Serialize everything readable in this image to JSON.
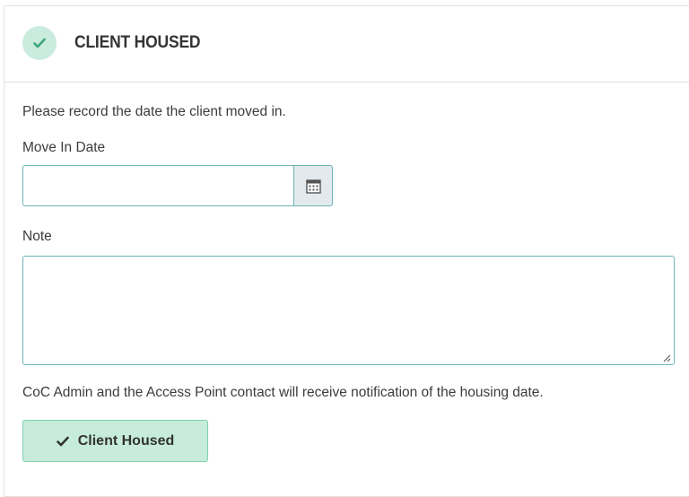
{
  "header": {
    "title": "CLIENT HOUSED",
    "status_icon": "check-icon",
    "status_color": "#c9ecdf",
    "check_color": "#3aa57a"
  },
  "form": {
    "intro_text": "Please record the date the client moved in.",
    "move_in_label": "Move In Date",
    "move_in_value": "",
    "calendar_icon": "calendar-icon",
    "note_label": "Note",
    "note_value": "",
    "notification_text": "CoC Admin and the Access Point contact will receive notification of the housing date.",
    "submit_label": "Client Housed",
    "submit_icon": "check-icon",
    "submit_color": "#c7ecdc"
  }
}
